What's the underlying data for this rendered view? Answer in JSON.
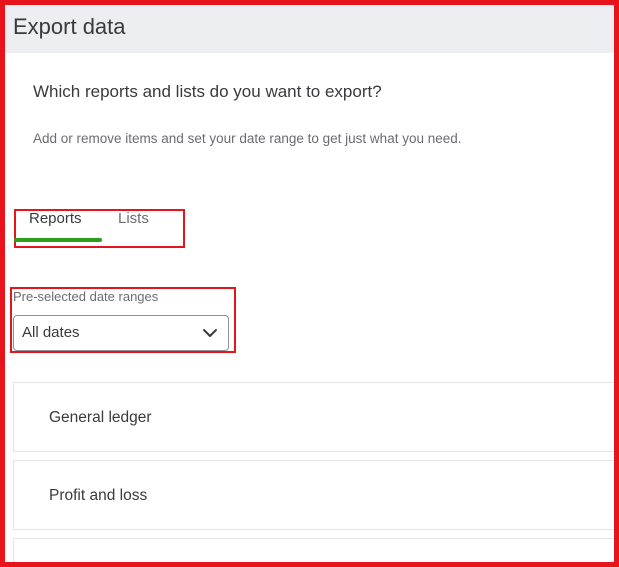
{
  "header": {
    "title": "Export data"
  },
  "intro": {
    "question": "Which reports and lists do you want to export?",
    "subtitle": "Add or remove items and set your date range to get just what you need."
  },
  "tabs": [
    {
      "label": "Reports",
      "active": true
    },
    {
      "label": "Lists",
      "active": false
    }
  ],
  "date_range": {
    "label": "Pre-selected date ranges",
    "selected": "All dates"
  },
  "reports": [
    {
      "label": "General ledger"
    },
    {
      "label": "Profit and loss"
    }
  ],
  "colors": {
    "accent_green": "#2ca01c",
    "highlight_red": "#e8141c",
    "header_bg": "#eceef1",
    "text": "#393a3d",
    "muted_text": "#6b6c72"
  },
  "icons": {
    "dropdown": "chevron-down-icon"
  }
}
